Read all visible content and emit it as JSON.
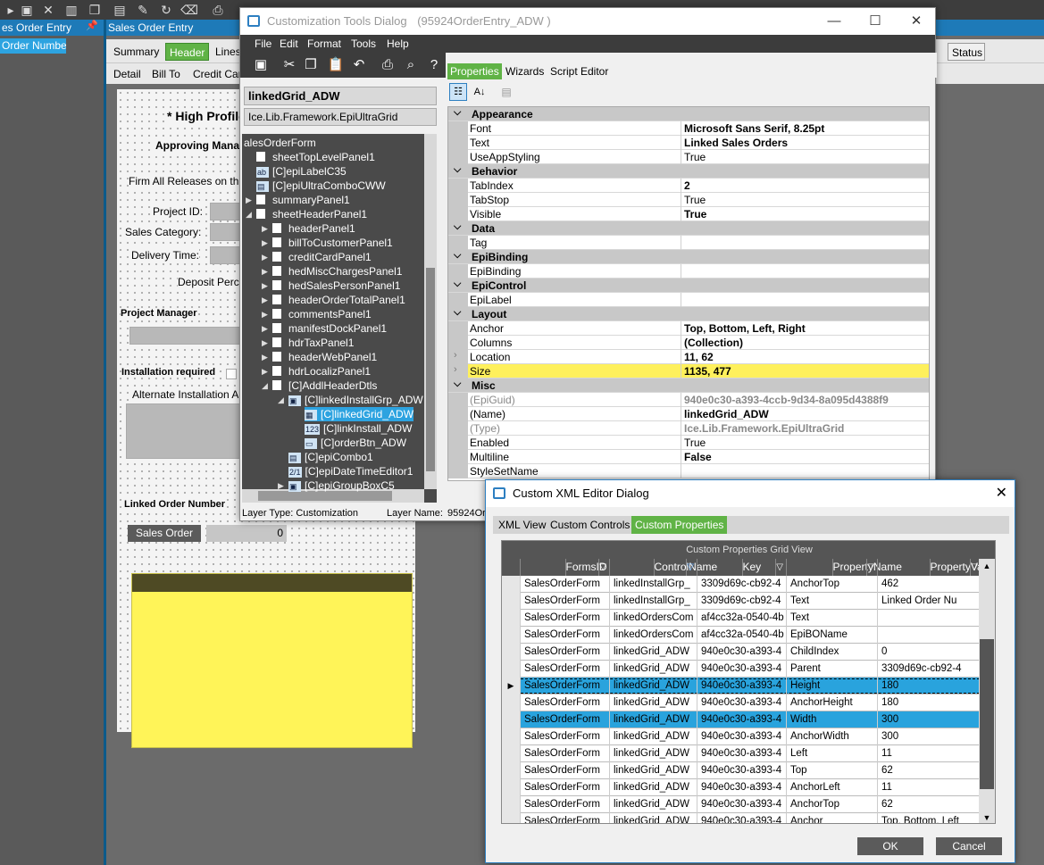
{
  "background_app": {
    "left_panel_title": "es Order Entry",
    "left_panel_selected": "Order Number",
    "window_title": "Sales Order Entry",
    "tabs": [
      "Summary",
      "Header",
      "Lines"
    ],
    "active_tab": "Header",
    "status_tab": "Status",
    "subtabs": [
      "Detail",
      "Bill To",
      "Credit Car"
    ],
    "form_labels": {
      "high_profile": "* High Profile",
      "approving_manager": "Approving Manag",
      "firm_all_releases": "Firm All Releases on th",
      "project_id": "Project ID:",
      "sales_category": "Sales Category:",
      "delivery_time": "Delivery Time:",
      "deposit_percent": "Deposit Perc",
      "project_manager": "Project Manager",
      "installation_required": "Installation required",
      "alternate_installation": "Alternate Installation A",
      "linked_order_number": "Linked Order Number",
      "sales_order_button": "Sales Order",
      "sales_order_value": "0"
    }
  },
  "customization_dialog": {
    "title": "Customization Tools Dialog",
    "title_suffix": "(95924OrderEntry_ADW )",
    "menu": [
      "File",
      "Edit",
      "Format",
      "Tools",
      "Help"
    ],
    "right_tabs": [
      "Properties",
      "Wizards",
      "Script Editor"
    ],
    "active_right_tab": "Properties",
    "control_name": "linkedGrid_ADW",
    "control_type": "Ice.Lib.Framework.EpiUltraGrid",
    "tree": [
      {
        "label": "alesOrderForm",
        "depth": 0,
        "icon": "none"
      },
      {
        "label": "sheetTopLevelPanel1",
        "depth": 1,
        "icon": "box"
      },
      {
        "label": "[C]epiLabelC35",
        "depth": 1,
        "icon": "label"
      },
      {
        "label": "[C]epiUltraComboCWW",
        "depth": 1,
        "icon": "combo"
      },
      {
        "label": "summaryPanel1",
        "depth": 1,
        "icon": "box",
        "expand": "right"
      },
      {
        "label": "sheetHeaderPanel1",
        "depth": 1,
        "icon": "box",
        "expand": "down"
      },
      {
        "label": "headerPanel1",
        "depth": 2,
        "icon": "box",
        "expand": "right"
      },
      {
        "label": "billToCustomerPanel1",
        "depth": 2,
        "icon": "box",
        "expand": "right"
      },
      {
        "label": "creditCardPanel1",
        "depth": 2,
        "icon": "box",
        "expand": "right"
      },
      {
        "label": "hedMiscChargesPanel1",
        "depth": 2,
        "icon": "box",
        "expand": "right"
      },
      {
        "label": "hedSalesPersonPanel1",
        "depth": 2,
        "icon": "box",
        "expand": "right"
      },
      {
        "label": "headerOrderTotalPanel1",
        "depth": 2,
        "icon": "box",
        "expand": "right"
      },
      {
        "label": "commentsPanel1",
        "depth": 2,
        "icon": "box",
        "expand": "right"
      },
      {
        "label": "manifestDockPanel1",
        "depth": 2,
        "icon": "box",
        "expand": "right"
      },
      {
        "label": "hdrTaxPanel1",
        "depth": 2,
        "icon": "box",
        "expand": "right"
      },
      {
        "label": "headerWebPanel1",
        "depth": 2,
        "icon": "box",
        "expand": "right"
      },
      {
        "label": "hdrLocalizPanel1",
        "depth": 2,
        "icon": "box",
        "expand": "right"
      },
      {
        "label": "[C]AddlHeaderDtls",
        "depth": 2,
        "icon": "box",
        "expand": "down"
      },
      {
        "label": "[C]linkedInstallGrp_ADW",
        "depth": 3,
        "icon": "group",
        "expand": "down"
      },
      {
        "label": "[C]linkedGrid_ADW",
        "depth": 4,
        "icon": "grid",
        "selected": true
      },
      {
        "label": "[C]linkInstall_ADW",
        "depth": 4,
        "icon": "num"
      },
      {
        "label": "[C]orderBtn_ADW",
        "depth": 4,
        "icon": "btn"
      },
      {
        "label": "[C]epiCombo1",
        "depth": 3,
        "icon": "combo"
      },
      {
        "label": "[C]epiDateTimeEditor1",
        "depth": 3,
        "icon": "date"
      },
      {
        "label": "[C]epiGroupBoxC5",
        "depth": 3,
        "icon": "group",
        "expand": "right"
      }
    ],
    "layer_type_label": "Layer Type:",
    "layer_type_value": "Customization",
    "layer_name_label": "Layer Name:",
    "layer_name_value": "95924Or",
    "properties": [
      {
        "kind": "cat",
        "name": "Appearance"
      },
      {
        "kind": "prop",
        "name": "Font",
        "value": "Microsoft Sans Serif, 8.25pt",
        "bold": true
      },
      {
        "kind": "prop",
        "name": "Text",
        "value": "Linked Sales Orders",
        "bold": true
      },
      {
        "kind": "prop",
        "name": "UseAppStyling",
        "value": "True"
      },
      {
        "kind": "cat",
        "name": "Behavior"
      },
      {
        "kind": "prop",
        "name": "TabIndex",
        "value": "2",
        "bold": true
      },
      {
        "kind": "prop",
        "name": "TabStop",
        "value": "True"
      },
      {
        "kind": "prop",
        "name": "Visible",
        "value": "True",
        "bold": true
      },
      {
        "kind": "cat",
        "name": "Data"
      },
      {
        "kind": "prop",
        "name": "Tag",
        "value": ""
      },
      {
        "kind": "cat",
        "name": "EpiBinding"
      },
      {
        "kind": "prop",
        "name": "EpiBinding",
        "value": ""
      },
      {
        "kind": "cat",
        "name": "EpiControl"
      },
      {
        "kind": "prop",
        "name": "EpiLabel",
        "value": ""
      },
      {
        "kind": "cat",
        "name": "Layout"
      },
      {
        "kind": "prop",
        "name": "Anchor",
        "value": "Top, Bottom, Left, Right",
        "bold": true
      },
      {
        "kind": "prop",
        "name": "Columns",
        "value": "(Collection)",
        "bold": true
      },
      {
        "kind": "prop",
        "name": "Location",
        "value": "11, 62",
        "bold": true,
        "expandable": true
      },
      {
        "kind": "prop",
        "name": "Size",
        "value": "1135, 477",
        "bold": true,
        "expandable": true,
        "highlight": true
      },
      {
        "kind": "cat",
        "name": "Misc"
      },
      {
        "kind": "prop",
        "name": "(EpiGuid)",
        "value": "940e0c30-a393-4ccb-9d34-8a095d4388f9",
        "bold": true,
        "gray": true
      },
      {
        "kind": "prop",
        "name": "(Name)",
        "value": "linkedGrid_ADW",
        "bold": true
      },
      {
        "kind": "prop",
        "name": "(Type)",
        "value": "Ice.Lib.Framework.EpiUltraGrid",
        "bold": true,
        "gray": true
      },
      {
        "kind": "prop",
        "name": "Enabled",
        "value": "True"
      },
      {
        "kind": "prop",
        "name": "Multiline",
        "value": "False",
        "bold": true
      },
      {
        "kind": "prop",
        "name": "StyleSetName",
        "value": ""
      }
    ]
  },
  "xml_dialog": {
    "title": "Custom XML Editor Dialog",
    "tabs": [
      "XML View",
      "Custom Controls",
      "Custom Properties"
    ],
    "active_tab": "Custom Properties",
    "grid_caption": "Custom Properties Grid View",
    "columns": [
      "FormsID",
      "ControlName",
      "Key",
      "PropertyName",
      "PropertyValue"
    ],
    "rows": [
      [
        "SalesOrderForm",
        "linkedInstallGrp_",
        "3309d69c-cb92-4",
        "AnchorTop",
        "462"
      ],
      [
        "SalesOrderForm",
        "linkedInstallGrp_",
        "3309d69c-cb92-4",
        "Text",
        "Linked Order Nu"
      ],
      [
        "SalesOrderForm",
        "linkedOrdersCom",
        "af4cc32a-0540-4b",
        "Text",
        ""
      ],
      [
        "SalesOrderForm",
        "linkedOrdersCom",
        "af4cc32a-0540-4b",
        "EpiBOName",
        ""
      ],
      [
        "SalesOrderForm",
        "linkedGrid_ADW",
        "940e0c30-a393-4",
        "ChildIndex",
        "0"
      ],
      [
        "SalesOrderForm",
        "linkedGrid_ADW",
        "940e0c30-a393-4",
        "Parent",
        "3309d69c-cb92-4"
      ],
      [
        "SalesOrderForm",
        "linkedGrid_ADW",
        "940e0c30-a393-4",
        "Height",
        "180"
      ],
      [
        "SalesOrderForm",
        "linkedGrid_ADW",
        "940e0c30-a393-4",
        "AnchorHeight",
        "180"
      ],
      [
        "SalesOrderForm",
        "linkedGrid_ADW",
        "940e0c30-a393-4",
        "Width",
        "300"
      ],
      [
        "SalesOrderForm",
        "linkedGrid_ADW",
        "940e0c30-a393-4",
        "AnchorWidth",
        "300"
      ],
      [
        "SalesOrderForm",
        "linkedGrid_ADW",
        "940e0c30-a393-4",
        "Left",
        "11"
      ],
      [
        "SalesOrderForm",
        "linkedGrid_ADW",
        "940e0c30-a393-4",
        "Top",
        "62"
      ],
      [
        "SalesOrderForm",
        "linkedGrid_ADW",
        "940e0c30-a393-4",
        "AnchorLeft",
        "11"
      ],
      [
        "SalesOrderForm",
        "linkedGrid_ADW",
        "940e0c30-a393-4",
        "AnchorTop",
        "62"
      ],
      [
        "SalesOrderForm",
        "linkedGrid_ADW",
        "940e0c30-a393-4",
        "Anchor",
        "Top, Bottom, Left"
      ]
    ],
    "current_row": 6,
    "selected_rows": [
      6,
      8
    ],
    "ok_label": "OK",
    "cancel_label": "Cancel"
  }
}
